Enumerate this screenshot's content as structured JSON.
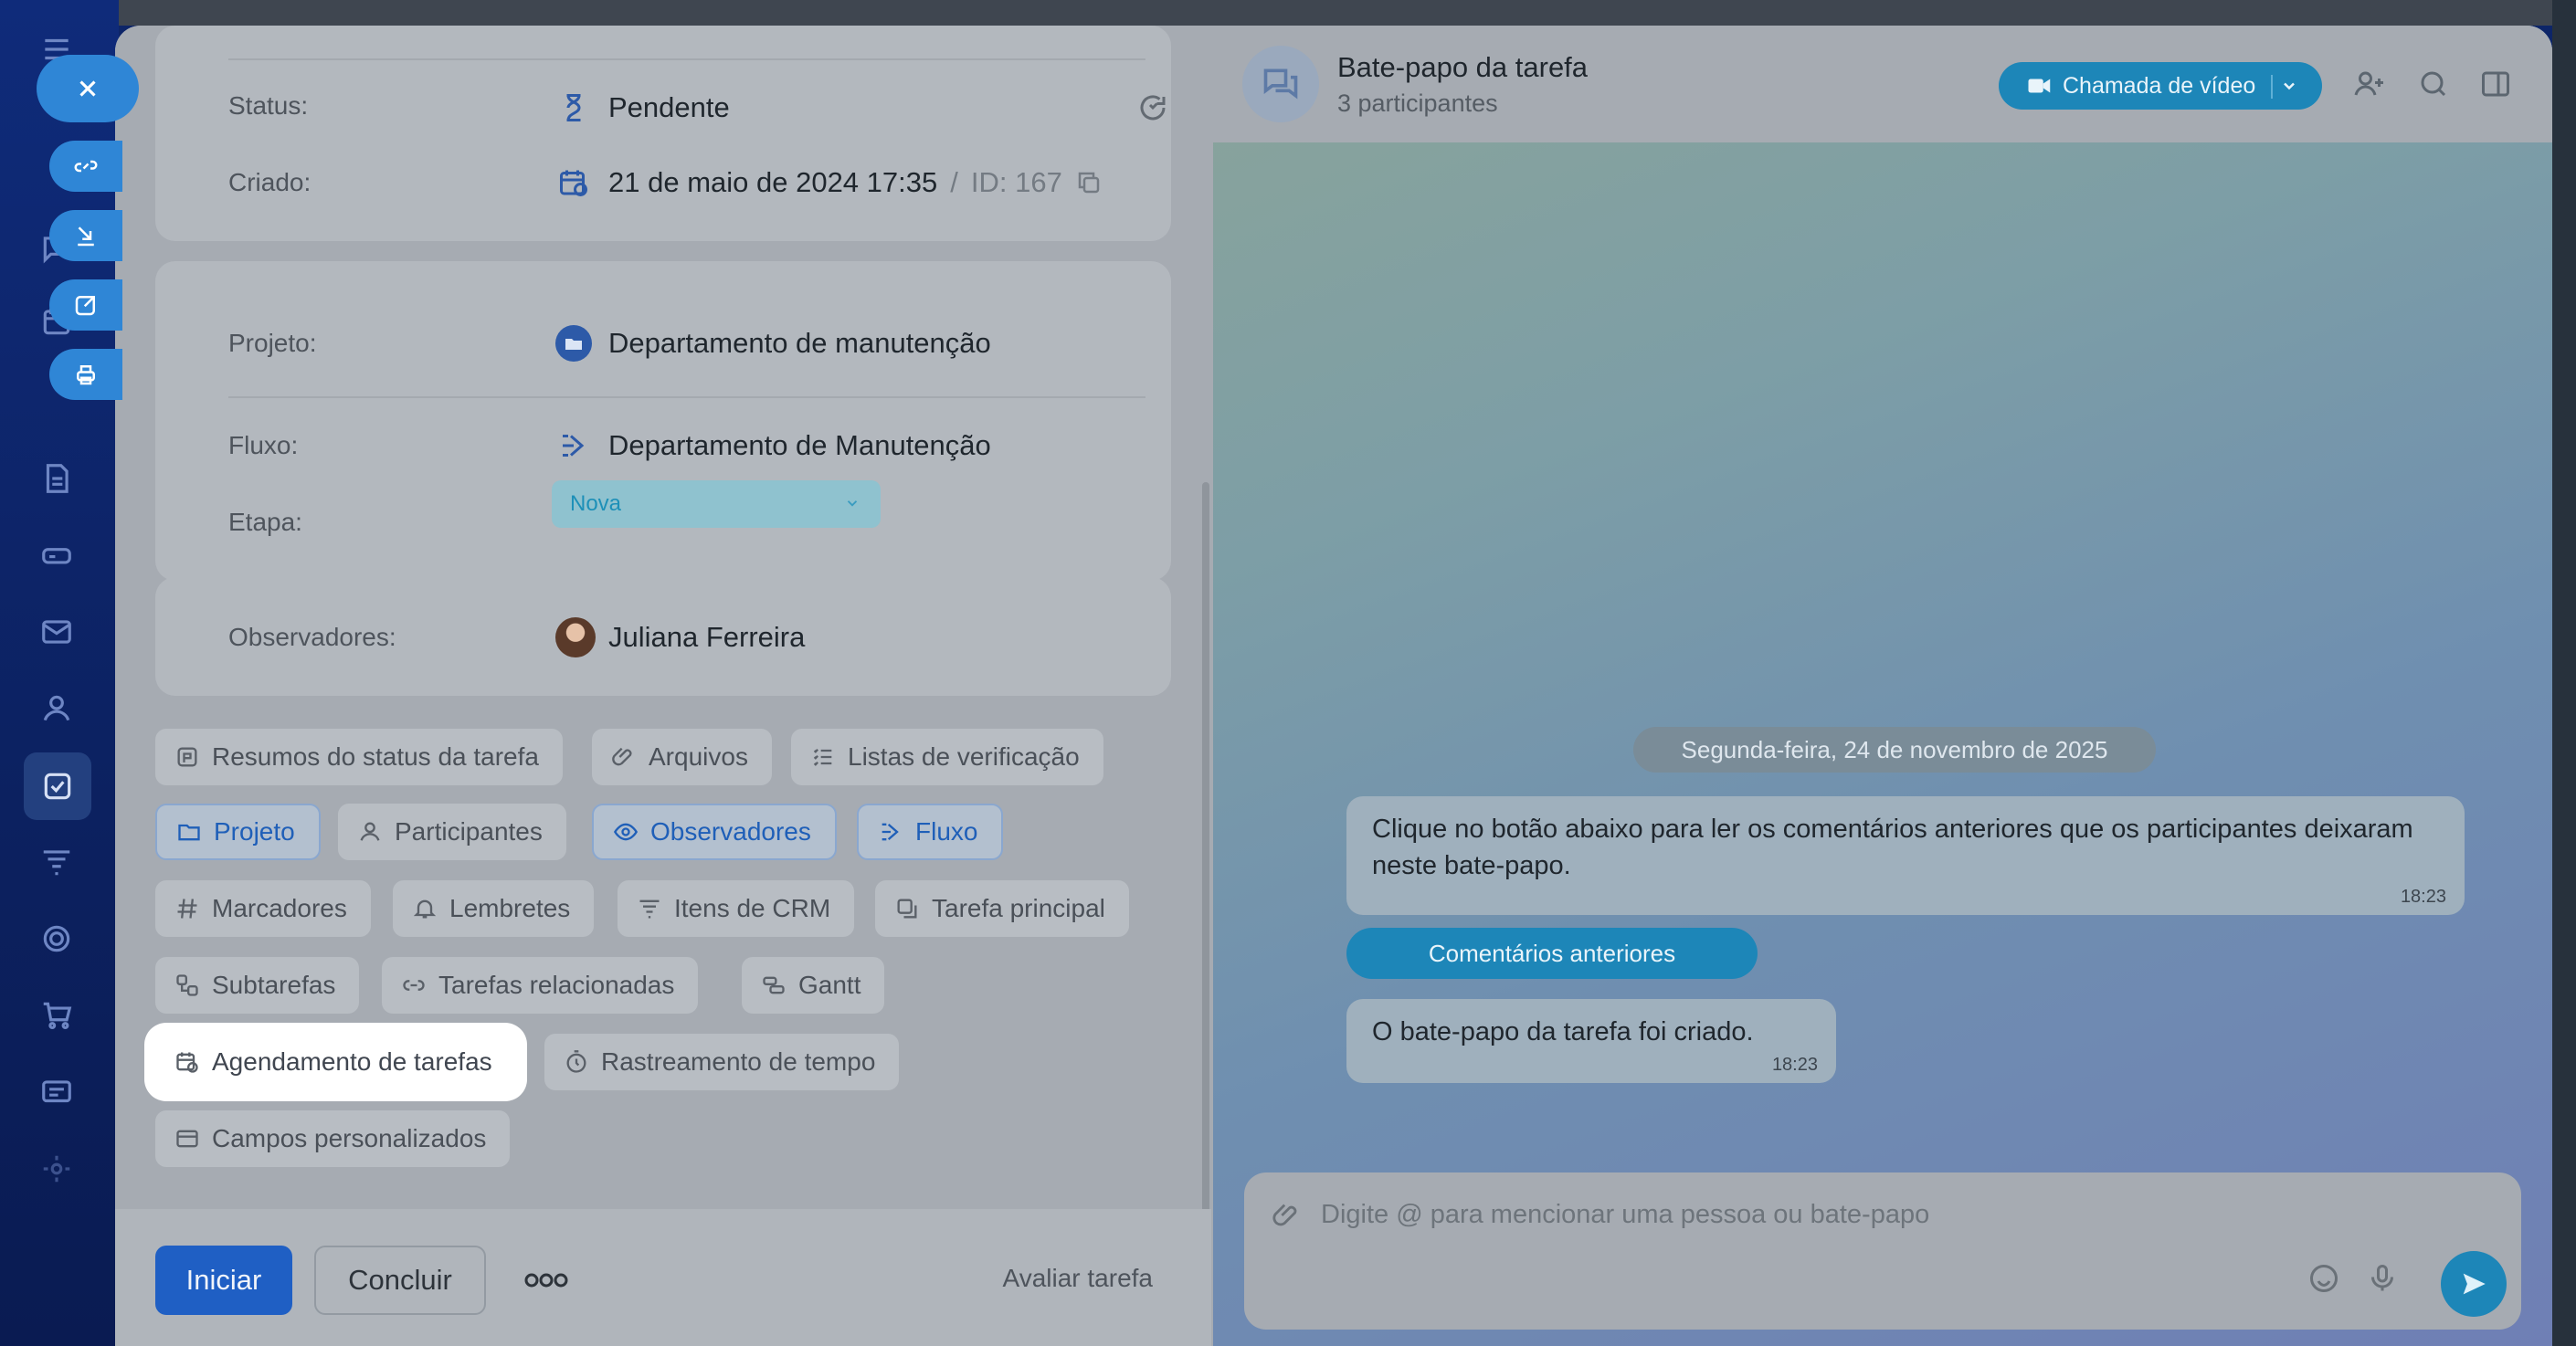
{
  "task": {
    "status_label": "Status:",
    "status_value": "Pendente",
    "created_label": "Criado:",
    "created_value": "21 de maio de 2024 17:35",
    "id_sep": "/",
    "id_value": "ID: 167",
    "project_label": "Projeto:",
    "project_value": "Departamento de manutenção",
    "flow_label": "Fluxo:",
    "flow_value": "Departamento de Manutenção",
    "stage_label": "Etapa:",
    "stage_value": "Nova",
    "observers_label": "Observadores:",
    "observer_name": "Juliana Ferreira"
  },
  "chips": {
    "status_summaries": "Resumos do status da tarefa",
    "files": "Arquivos",
    "checklists": "Listas de verificação",
    "project": "Projeto",
    "participants": "Participantes",
    "observers": "Observadores",
    "flow": "Fluxo",
    "tags": "Marcadores",
    "reminders": "Lembretes",
    "crm_items": "Itens de CRM",
    "main_task": "Tarefa principal",
    "subtasks": "Subtarefas",
    "related_tasks": "Tarefas relacionadas",
    "gantt": "Gantt",
    "scheduling": "Agendamento de tarefas",
    "time_tracking": "Rastreamento de tempo",
    "custom_fields": "Campos personalizados"
  },
  "footer": {
    "start": "Iniciar",
    "complete": "Concluir",
    "rate": "Avaliar tarefa"
  },
  "chat": {
    "title": "Bate-papo da tarefa",
    "subtitle": "3 participantes",
    "video_call": "Chamada de vídeo",
    "date_separator": "Segunda-feira, 24 de novembro de 2025",
    "message1": "Clique no botão abaixo para ler os comentários anteriores que os participantes deixaram neste bate-papo.",
    "message1_time": "18:23",
    "previous_comments": "Comentários anteriores",
    "message2": "O bate-papo da tarefa foi criado.",
    "message2_time": "18:23",
    "input_placeholder": "Digite @ para mencionar uma pessoa ou bate-papo"
  },
  "colors": {
    "accent": "#1d86b8",
    "primary_button": "#1f5fc4",
    "rail": "#0f2b7a"
  }
}
